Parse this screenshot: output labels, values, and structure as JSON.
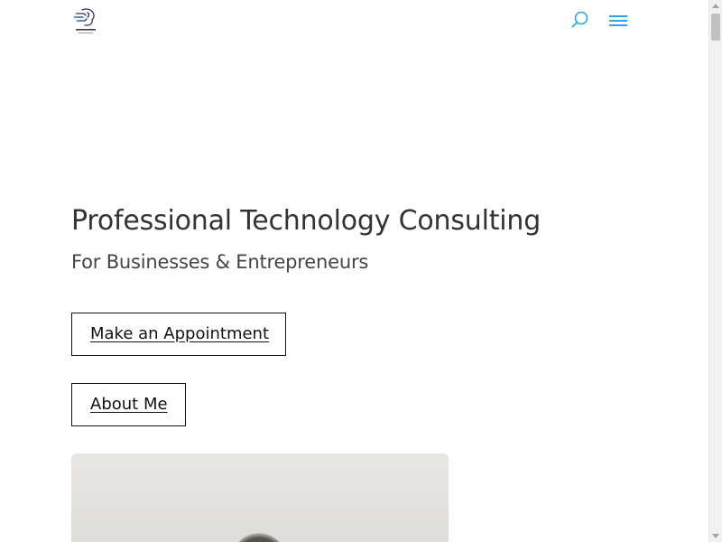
{
  "header": {
    "logo_icon": "brain-circuit-logo-icon",
    "search_icon": "search-icon",
    "menu_icon": "hamburger-menu-icon",
    "accent_color": "#2ea3f2"
  },
  "hero": {
    "title": "Professional Technology Consulting",
    "subtitle": "For Businesses & Entrepreneurs",
    "primary_button": "Make an Appointment",
    "secondary_button": "About Me"
  },
  "photo": {
    "icon": "portrait-photo"
  }
}
